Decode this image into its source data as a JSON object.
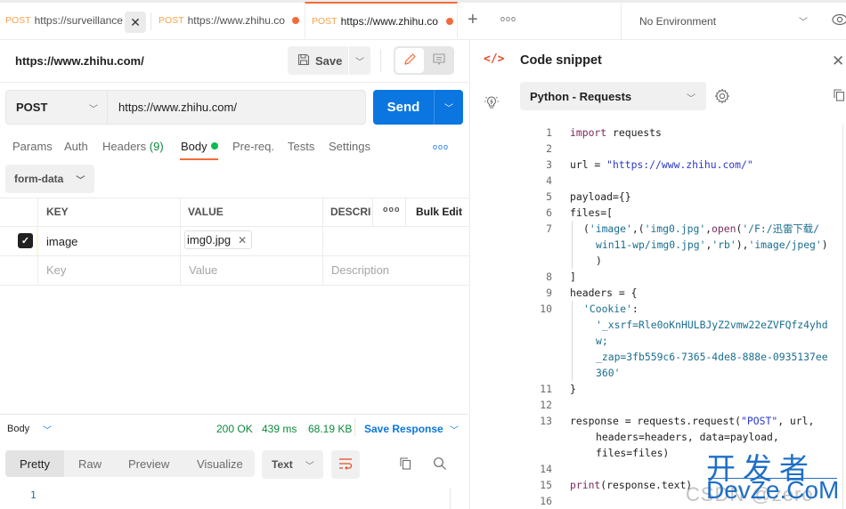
{
  "tabs": [
    {
      "method": "POST",
      "url": "https://surveillance-a",
      "state": "hover-close"
    },
    {
      "method": "POST",
      "url": "https://www.zhihu.co",
      "state": "unsaved"
    },
    {
      "method": "POST",
      "url": "https://www.zhihu.co",
      "state": "active-unsaved"
    }
  ],
  "tabbar": {
    "new_tab_icon": "plus-icon",
    "more_icon": "ellipsis-icon",
    "environment": "No Environment",
    "env_icon": "eye-icon"
  },
  "request": {
    "title": "https://www.zhihu.com/",
    "save_label": "Save",
    "method": "POST",
    "url": "https://www.zhihu.com/",
    "send_label": "Send"
  },
  "request_tabs": [
    {
      "label": "Params"
    },
    {
      "label": "Auth"
    },
    {
      "label": "Headers",
      "count": "(9)"
    },
    {
      "label": "Body",
      "active": true,
      "indicator": "green-dot"
    },
    {
      "label": "Pre-req."
    },
    {
      "label": "Tests"
    },
    {
      "label": "Settings"
    }
  ],
  "body_mode": "form-data",
  "params_table": {
    "headers": [
      "KEY",
      "VALUE",
      "DESCRIF",
      "Bulk Edit"
    ],
    "rows": [
      {
        "checked": true,
        "key": "image",
        "value": "img0.jpg",
        "value_type": "file",
        "description": ""
      }
    ],
    "placeholder": {
      "key": "Key",
      "value": "Value",
      "description": "Description"
    }
  },
  "response": {
    "section_label": "Body",
    "status": "200 OK",
    "time": "439 ms",
    "size": "68.19 KB",
    "save_label": "Save Response",
    "view_modes": [
      "Pretty",
      "Raw",
      "Preview",
      "Visualize"
    ],
    "active_view": "Pretty",
    "format": "Text",
    "line_numbers": [
      "1"
    ]
  },
  "code_snippet": {
    "title": "Code snippet",
    "language": "Python - Requests",
    "lines": [
      {
        "n": "1",
        "text": "import requests"
      },
      {
        "n": "2",
        "text": ""
      },
      {
        "n": "3",
        "text": "url = \"https://www.zhihu.com/\""
      },
      {
        "n": "4",
        "text": ""
      },
      {
        "n": "5",
        "text": "payload={}"
      },
      {
        "n": "6",
        "text": "files=["
      },
      {
        "n": "7",
        "text": "('image',('img0.jpg',open('/F:/迅雷下载/",
        "cont": [
          "win11-wp/img0.jpg','rb'),'image/jpeg')",
          ")"
        ]
      },
      {
        "n": "8",
        "text": "]"
      },
      {
        "n": "9",
        "text": "headers = {"
      },
      {
        "n": "10",
        "text": "'Cookie':",
        "cont": [
          "'_xsrf=Rle0oKnHULBJyZ2vmw22eZVFQfz4yhd",
          "w;",
          "_zap=3fb559c6-7365-4de8-888e-0935137ee",
          "360'"
        ]
      },
      {
        "n": "11",
        "text": "}"
      },
      {
        "n": "12",
        "text": ""
      },
      {
        "n": "13",
        "text": "response = requests.request(\"POST\", url,",
        "cont": [
          "headers=headers, data=payload,",
          "files=files)"
        ]
      },
      {
        "n": "14",
        "text": ""
      },
      {
        "n": "15",
        "text": "print(response.text)"
      },
      {
        "n": "16",
        "text": ""
      }
    ]
  },
  "watermark": {
    "cn": "开发者",
    "en": "DevZe.CoM",
    "gray": "CSDN @zero"
  },
  "colors": {
    "accent": "#f26b3a",
    "primary": "#0b76e0",
    "success": "#0c8a3c",
    "method_post": "#f5a24a"
  }
}
